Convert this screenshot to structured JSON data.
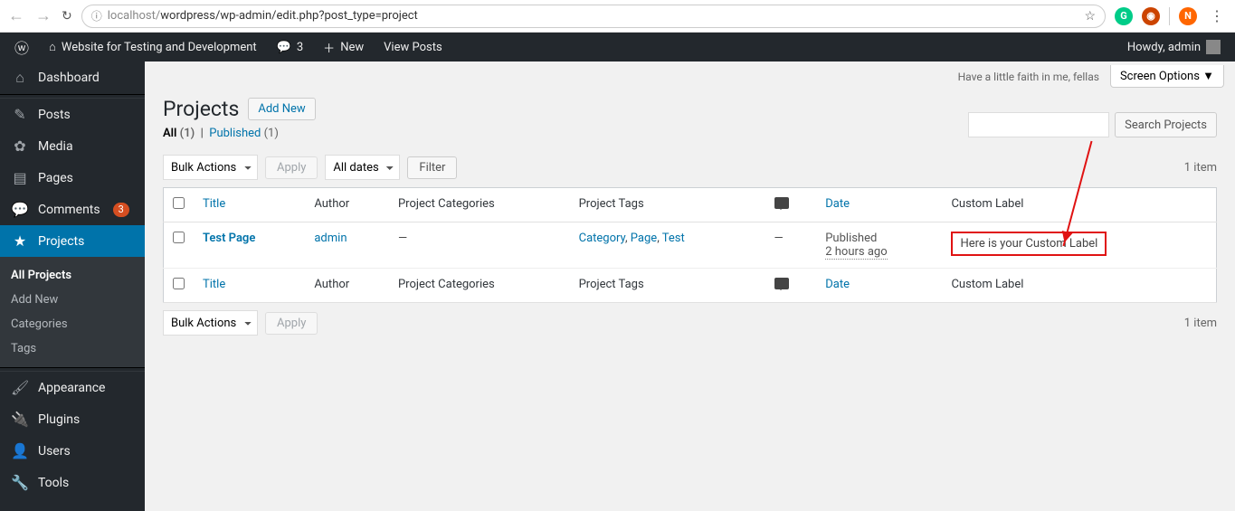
{
  "browser": {
    "url_muted": "localhost/",
    "url": "wordpress/wp-admin/edit.php?post_type=project"
  },
  "adminbar": {
    "site_name": "Website for Testing and Development",
    "comments_count": "3",
    "new_label": "New",
    "view_posts": "View Posts",
    "howdy": "Howdy, admin"
  },
  "sidebar": {
    "items": [
      {
        "icon": "⌂",
        "label": "Dashboard"
      },
      {
        "icon": "✎",
        "label": "Posts"
      },
      {
        "icon": "✿",
        "label": "Media"
      },
      {
        "icon": "▤",
        "label": "Pages"
      },
      {
        "icon": "💬",
        "label": "Comments",
        "badge": "3"
      },
      {
        "icon": "★",
        "label": "Projects",
        "current": true
      },
      {
        "icon": "🖌",
        "label": "Appearance"
      },
      {
        "icon": "🔌",
        "label": "Plugins"
      },
      {
        "icon": "👤",
        "label": "Users"
      },
      {
        "icon": "🔧",
        "label": "Tools"
      }
    ],
    "submenu": [
      {
        "label": "All Projects",
        "current": true
      },
      {
        "label": "Add New"
      },
      {
        "label": "Categories"
      },
      {
        "label": "Tags"
      }
    ]
  },
  "content": {
    "faith": "Have a little faith in me, fellas",
    "screen_options": "Screen Options",
    "page_title": "Projects",
    "add_new": "Add New",
    "filter_all": "All",
    "filter_all_count": "(1)",
    "filter_published": "Published",
    "filter_published_count": "(1)",
    "bulk_actions": "Bulk Actions",
    "apply": "Apply",
    "all_dates": "All dates",
    "filter": "Filter",
    "item_count": "1 item",
    "search_btn": "Search Projects",
    "columns": {
      "title": "Title",
      "author": "Author",
      "cats": "Project Categories",
      "tags": "Project Tags",
      "date": "Date",
      "custom": "Custom Label"
    },
    "row": {
      "title": "Test Page",
      "author": "admin",
      "cats": "—",
      "tag1": "Category",
      "tag2": "Page",
      "tag3": "Test",
      "comments": "—",
      "date_status": "Published",
      "date_time": "2 hours ago",
      "custom": "Here is your Custom Label"
    }
  }
}
